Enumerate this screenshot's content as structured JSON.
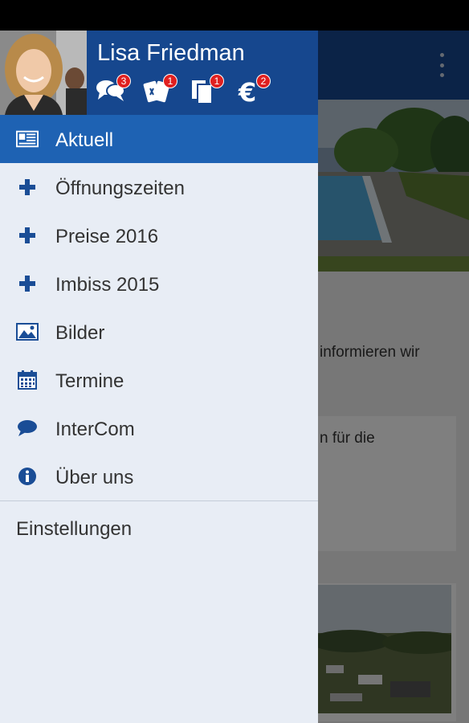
{
  "user": {
    "name": "Lisa Friedman"
  },
  "badges": [
    {
      "icon": "chat-bubbles-icon",
      "count": "3"
    },
    {
      "icon": "vouchers-icon",
      "count": "1"
    },
    {
      "icon": "documents-icon",
      "count": "1"
    },
    {
      "icon": "euro-icon",
      "count": "2"
    }
  ],
  "menu": {
    "items": [
      {
        "label": "Aktuell",
        "icon": "news-icon"
      },
      {
        "label": "Öffnungszeiten",
        "icon": "plus-icon"
      },
      {
        "label": "Preise 2016",
        "icon": "plus-icon"
      },
      {
        "label": "Imbiss 2015",
        "icon": "plus-icon"
      },
      {
        "label": "Bilder",
        "icon": "image-icon"
      },
      {
        "label": "Termine",
        "icon": "calendar-icon"
      },
      {
        "label": "InterCom",
        "icon": "chat-icon"
      },
      {
        "label": "Über uns",
        "icon": "info-icon"
      }
    ],
    "settings": "Einstellungen"
  },
  "background": {
    "text1": "informieren wir",
    "text2": "n für die"
  },
  "colors": {
    "primary": "#16478e",
    "active": "#1e62b3",
    "badge": "#e02020",
    "drawer": "#e8edf5"
  }
}
